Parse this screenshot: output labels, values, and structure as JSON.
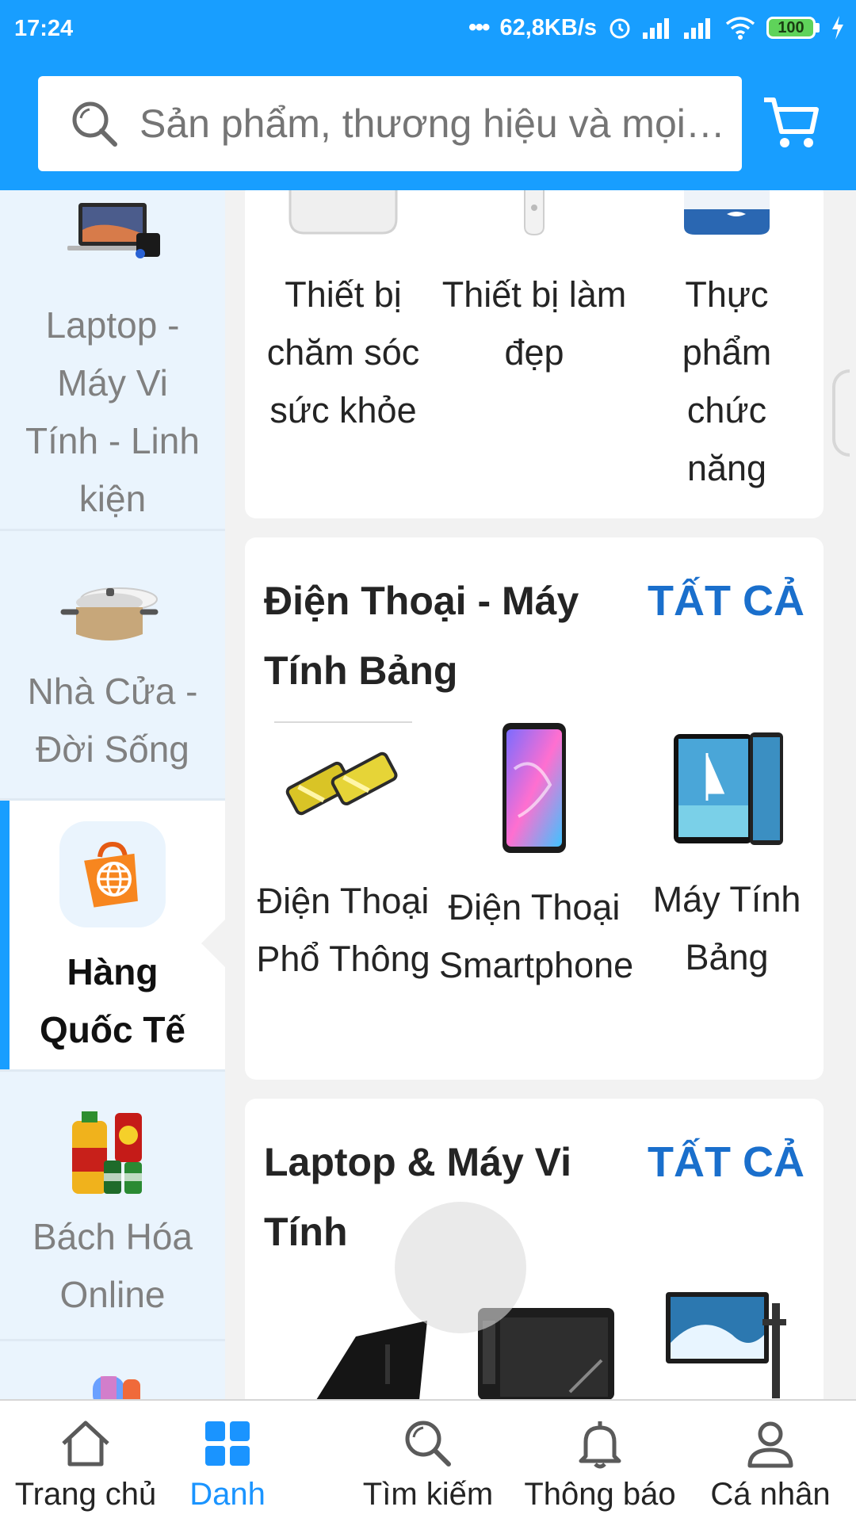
{
  "status_bar": {
    "time": "17:24",
    "network_speed": "62,8KB/s",
    "battery": "100",
    "icons": [
      "more-dots-icon",
      "alarm-icon",
      "signal-icon",
      "signal-icon",
      "wifi-icon",
      "battery-icon",
      "charging-icon"
    ]
  },
  "search": {
    "placeholder": "Sản phẩm, thương hiệu và mọi thứ bạn cần...",
    "icon": "search-icon",
    "cart_icon": "cart-icon"
  },
  "sidebar": {
    "categories": [
      {
        "label": "Laptop - Máy Vi Tính - Linh kiện",
        "icon": "laptop-image",
        "active": false
      },
      {
        "label": "Nhà Cửa - Đời Sống",
        "icon": "pot-image",
        "active": false
      },
      {
        "label": "Hàng Quốc Tế",
        "icon": "globe-bag-icon",
        "active": true
      },
      {
        "label": "Bách Hóa Online",
        "icon": "grocery-image",
        "active": false
      },
      {
        "label": "",
        "icon": "speaker-image",
        "active": false
      }
    ]
  },
  "sections": [
    {
      "title": "",
      "see_all": "",
      "items": [
        {
          "label": "Thiết bị chăm sóc sức khỏe"
        },
        {
          "label": "Thiết bị làm đẹp"
        },
        {
          "label": "Thực phẩm chức năng"
        }
      ]
    },
    {
      "title": "Điện Thoại - Máy Tính Bảng",
      "see_all": "TẤT CẢ",
      "items": [
        {
          "label": "Điện Thoại Phổ Thông"
        },
        {
          "label": "Điện Thoại Smartphone"
        },
        {
          "label": "Máy Tính Bảng"
        }
      ]
    },
    {
      "title": "Laptop & Máy Vi Tính",
      "see_all": "TẤT CẢ",
      "items": [
        {
          "label": ""
        },
        {
          "label": ""
        },
        {
          "label": ""
        }
      ]
    }
  ],
  "bottom_nav": [
    {
      "label": "Trang chủ",
      "icon": "home-icon",
      "active": false
    },
    {
      "label": "Danh",
      "icon": "category-grid-icon",
      "active": true
    },
    {
      "label": "Tìm kiếm",
      "icon": "search-icon",
      "active": false
    },
    {
      "label": "Thông báo",
      "icon": "bell-icon",
      "active": false
    },
    {
      "label": "Cá nhân",
      "icon": "user-icon",
      "active": false
    }
  ],
  "colors": {
    "brand": "#189eff",
    "link": "#1a6fcc",
    "sidebar_bg": "#eaf4fd"
  }
}
